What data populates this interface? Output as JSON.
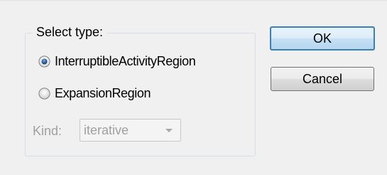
{
  "dialog": {
    "group_title": "Select type:",
    "radio_options": [
      {
        "label": "InterruptibleActivityRegion",
        "selected": true
      },
      {
        "label": "ExpansionRegion",
        "selected": false
      }
    ],
    "kind": {
      "label": "Kind:",
      "value": "iterative",
      "enabled": false
    },
    "buttons": {
      "ok_label": "OK",
      "cancel_label": "Cancel"
    }
  },
  "colors": {
    "dialog_background": "#f0f0f0",
    "disabled_text": "#a0a0a0",
    "default_button_border": "#3c7fb1",
    "radio_dot": "#1c3d60"
  },
  "icons": {
    "radio_selected": "radio-selected-icon",
    "radio_unselected": "radio-unselected-icon",
    "dropdown_arrow": "chevron-down-icon"
  }
}
